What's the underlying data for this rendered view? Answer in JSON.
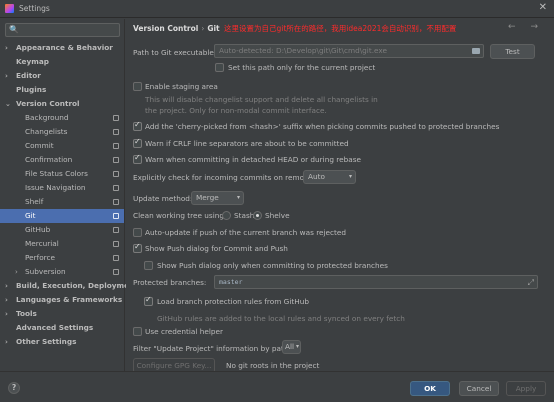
{
  "window": {
    "title": "Settings",
    "close_glyph": "✕"
  },
  "search": {
    "icon": "🔍",
    "value": ""
  },
  "sidebar": {
    "items": [
      {
        "label": "Appearance & Behavior",
        "arrow": "›",
        "bold": true
      },
      {
        "label": "Keymap",
        "bold": true
      },
      {
        "label": "Editor",
        "arrow": "›",
        "bold": true
      },
      {
        "label": "Plugins",
        "bold": true
      },
      {
        "label": "Version Control",
        "arrow": "⌄",
        "bold": true
      },
      {
        "label": "Background"
      },
      {
        "label": "Changelists"
      },
      {
        "label": "Commit"
      },
      {
        "label": "Confirmation"
      },
      {
        "label": "File Status Colors"
      },
      {
        "label": "Issue Navigation"
      },
      {
        "label": "Shelf"
      },
      {
        "label": "Git",
        "selected": true
      },
      {
        "label": "GitHub"
      },
      {
        "label": "Mercurial"
      },
      {
        "label": "Perforce"
      },
      {
        "label": "Subversion",
        "arrow": "›"
      },
      {
        "label": "Build, Execution, Deployment",
        "arrow": "›",
        "bold": true
      },
      {
        "label": "Languages & Frameworks",
        "arrow": "›",
        "bold": true
      },
      {
        "label": "Tools",
        "arrow": "›",
        "bold": true
      },
      {
        "label": "Advanced Settings",
        "bold": true
      },
      {
        "label": "Other Settings",
        "arrow": "›",
        "bold": true
      }
    ]
  },
  "header": {
    "crumb_1": "Version Control",
    "crumb_sep": "›",
    "crumb_2": "Git",
    "red_note": "这里设置为自己git所在的路径，我用idea2021会自动识别，不用配置",
    "nav": "← →"
  },
  "git": {
    "path_label": "Path to Git executable:",
    "path_placeholder": "Auto-detected: D:\\Develop\\git\\Git\\cmd\\git.exe",
    "test_button": "Test",
    "project_only": "Set this path only for the current project",
    "staging_label": "Enable staging area",
    "staging_desc_1": "This will disable changelist support and delete all changelists in",
    "staging_desc_2": "the project. Only for non-modal commit interface.",
    "cherry_pick": "Add the 'cherry-picked from <hash>' suffix when picking commits pushed to protected branches",
    "crlf": "Warn if CRLF line separators are about to be committed",
    "detached": "Warn when committing in detached HEAD or during rebase",
    "incoming_label": "Explicitly check for incoming commits on remotes:",
    "incoming_value": "Auto",
    "update_label": "Update method:",
    "update_value": "Merge",
    "clean_label": "Clean working tree using:",
    "stash": "Stash",
    "shelve": "Shelve",
    "auto_update": "Auto-update if push of the current branch was rejected",
    "push_dialog": "Show Push dialog for Commit and Push",
    "push_protected": "Show Push dialog only when committing to protected branches",
    "protected_label": "Protected branches:",
    "protected_value": "master",
    "github_rules": "Load branch protection rules from GitHub",
    "github_desc": "GitHub rules are added to the local rules and synced on every fetch",
    "credential": "Use credential helper",
    "filter_label": "Filter \"Update Project\" information by paths:",
    "filter_value": "All",
    "gpg_button": "Configure GPG Key...",
    "gpg_note": "No git roots in the project",
    "dropdown_glyph": "▾",
    "expand_glyph": "⤢"
  },
  "footer": {
    "help": "?",
    "ok": "OK",
    "cancel": "Cancel",
    "apply": "Apply"
  }
}
